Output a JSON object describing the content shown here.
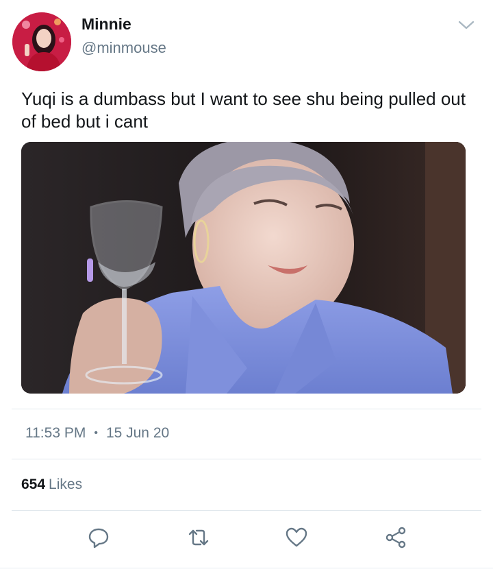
{
  "tweet": {
    "author": {
      "display_name": "Minnie",
      "handle": "@minmouse",
      "avatar_icon": "profile-photo"
    },
    "text": "Yuqi is a dumbass but I want to see shu being pulled out of bed but i cant",
    "media": {
      "description_icon": "embedded-photo"
    },
    "time": "11:53 PM",
    "separator": "•",
    "date": "15 Jun 20",
    "likes_count": "654",
    "likes_label": "Likes"
  },
  "actions": [
    {
      "name": "reply",
      "icon": "reply-icon"
    },
    {
      "name": "retweet",
      "icon": "retweet-icon"
    },
    {
      "name": "like",
      "icon": "heart-icon"
    },
    {
      "name": "share",
      "icon": "share-icon"
    }
  ],
  "colors": {
    "text": "#14171a",
    "secondary": "#657786",
    "divider": "#e1e8ed"
  }
}
